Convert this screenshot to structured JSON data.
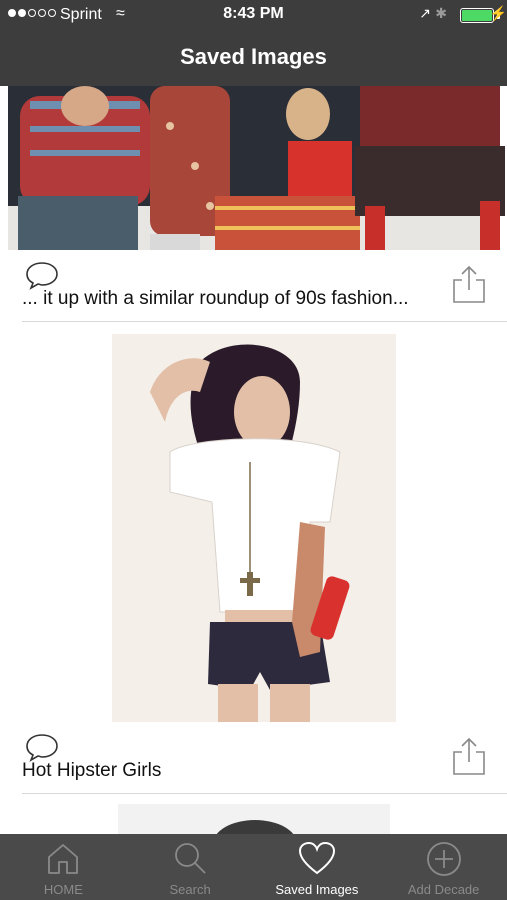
{
  "status_bar": {
    "carrier": "Sprint",
    "time": "8:43 PM",
    "wifi_symbol": "≈",
    "location_symbol": "↗",
    "bluetooth_symbol": "✱",
    "charge_symbol": "⚡",
    "battery_level": 1.0,
    "battery_color": "#4cd964",
    "signal_strength": 2
  },
  "nav": {
    "title": "Saved Images"
  },
  "feed": {
    "items": [
      {
        "caption": "... it up with a similar roundup of 90s fashion...",
        "image": "group-photo-90s-fashion"
      },
      {
        "caption": "Hot Hipster Girls",
        "image": "woman-white-tshirt-portrait"
      },
      {
        "caption": "",
        "image": "partial-portrait-bw"
      }
    ]
  },
  "tabbar": {
    "tabs": [
      {
        "label": "HOME",
        "icon": "home-icon",
        "active": false
      },
      {
        "label": "Search",
        "icon": "search-icon",
        "active": false
      },
      {
        "label": "Saved Images",
        "icon": "heart-icon",
        "active": true
      },
      {
        "label": "Add Decade",
        "icon": "plus-circle-icon",
        "active": false
      }
    ]
  },
  "colors": {
    "header": "#3d3d3d",
    "tabbar": "#4a4a4a",
    "active_tab": "#ffffff",
    "inactive_tab": "#8a8a8a"
  }
}
